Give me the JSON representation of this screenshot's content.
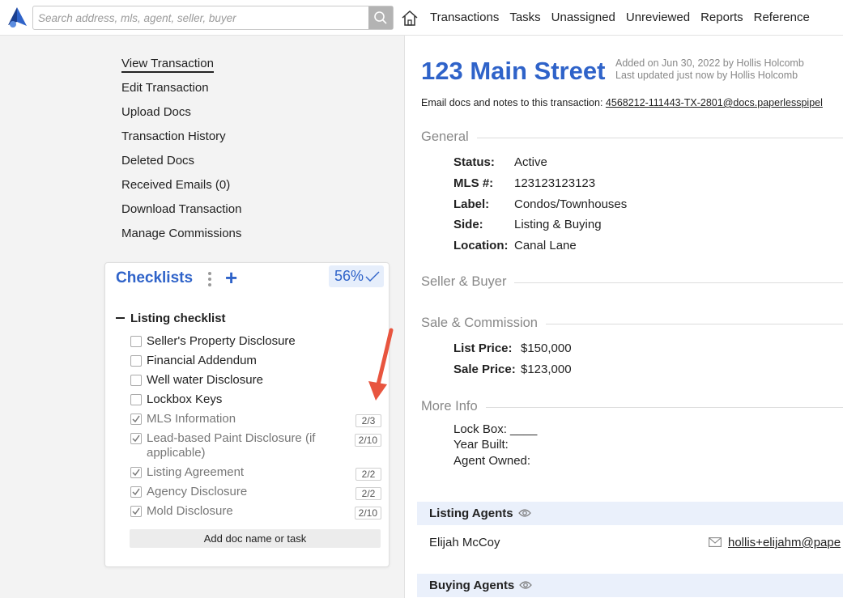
{
  "header": {
    "search_placeholder": "Search address, mls, agent, seller, buyer",
    "nav": [
      "Transactions",
      "Tasks",
      "Unassigned",
      "Unreviewed",
      "Reports",
      "Reference"
    ]
  },
  "sidebar": {
    "actions": [
      "View Transaction",
      "Edit Transaction",
      "Upload Docs",
      "Transaction History",
      "Deleted Docs",
      "Received Emails (0)",
      "Download Transaction",
      "Manage Commissions"
    ],
    "checklists": {
      "title": "Checklists",
      "percent": "56%",
      "group": "Listing checklist",
      "items": [
        {
          "label": "Seller's Property Disclosure",
          "checked": false,
          "count": ""
        },
        {
          "label": "Financial Addendum",
          "checked": false,
          "count": ""
        },
        {
          "label": "Well water Disclosure",
          "checked": false,
          "count": ""
        },
        {
          "label": "Lockbox Keys",
          "checked": false,
          "count": ""
        },
        {
          "label": "MLS Information",
          "checked": true,
          "count": "2/3"
        },
        {
          "label": "Lead-based Paint Disclosure (if applicable)",
          "checked": true,
          "count": "2/10"
        },
        {
          "label": "Listing Agreement",
          "checked": true,
          "count": "2/2"
        },
        {
          "label": "Agency Disclosure",
          "checked": true,
          "count": "2/2"
        },
        {
          "label": "Mold Disclosure",
          "checked": true,
          "count": "2/10"
        }
      ],
      "add_button": "Add doc name or task"
    }
  },
  "transaction": {
    "address": "123 Main Street",
    "added": "Added on Jun 30, 2022 by Hollis Holcomb",
    "updated": "Last updated just now by Hollis Holcomb",
    "email_prefix": "Email docs and notes to this transaction:",
    "email_address": "4568212-111443-TX-2801@docs.paperlesspipel",
    "sections": {
      "general": "General",
      "seller_buyer": "Seller & Buyer",
      "sale_commission": "Sale & Commission",
      "more_info": "More Info"
    },
    "general": {
      "status_k": "Status:",
      "status_v": "Active",
      "mls_k": "MLS #:",
      "mls_v": "123123123123",
      "label_k": "Label:",
      "label_v": "Condos/Townhouses",
      "side_k": "Side:",
      "side_v": "Listing & Buying",
      "location_k": "Location:",
      "location_v": "Canal Lane"
    },
    "sale": {
      "list_k": "List Price:",
      "list_v": "$150,000",
      "sale_k": "Sale Price:",
      "sale_v": "$123,000"
    },
    "more_info": {
      "lockbox": "Lock Box: ____",
      "year_built": "Year Built:",
      "agent_owned": "Agent Owned:"
    },
    "listing_agents": {
      "title": "Listing Agents",
      "name": "Elijah McCoy",
      "email": "hollis+elijahm@pape"
    },
    "buying_agents": {
      "title": "Buying Agents"
    }
  },
  "colors": {
    "accent": "#2f63c9",
    "arrow": "#e8553f"
  }
}
